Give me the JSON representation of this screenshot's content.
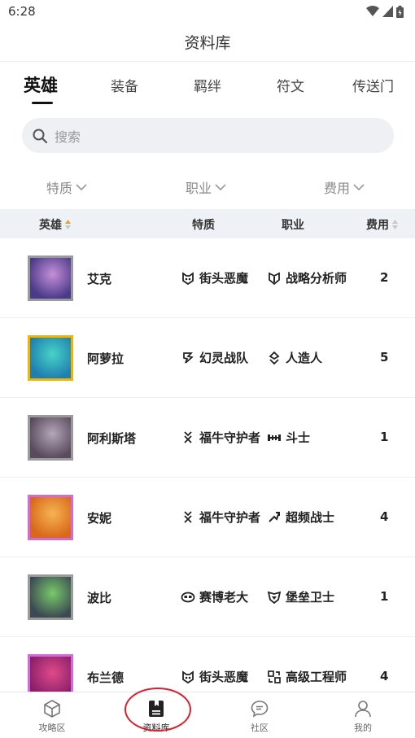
{
  "status_bar": {
    "time": "6:28"
  },
  "header": {
    "title": "资料库"
  },
  "tabs": [
    {
      "label": "英雄",
      "active": true
    },
    {
      "label": "装备",
      "active": false
    },
    {
      "label": "羁绊",
      "active": false
    },
    {
      "label": "符文",
      "active": false
    },
    {
      "label": "传送门",
      "active": false
    }
  ],
  "search": {
    "placeholder": "搜索"
  },
  "filters": [
    {
      "label": "特质"
    },
    {
      "label": "职业"
    },
    {
      "label": "费用"
    }
  ],
  "table": {
    "columns": [
      "英雄",
      "特质",
      "职业",
      "费用"
    ],
    "rows": [
      {
        "name": "艾克",
        "trait": "街头恶魔",
        "trait_icon": "street-demon-icon",
        "class": "战略分析师",
        "class_icon": "strategist-icon",
        "cost": "2",
        "border_color": "#9a9a9a",
        "portrait_colors": [
          "#4a3a8a",
          "#c58fd8"
        ]
      },
      {
        "name": "阿萝拉",
        "trait": "幻灵战队",
        "trait_icon": "star-guardian-icon",
        "class": "人造人",
        "class_icon": "cyborg-icon",
        "cost": "5",
        "border_color": "#f2b400",
        "portrait_colors": [
          "#1f7fb0",
          "#48d2c6"
        ]
      },
      {
        "name": "阿利斯塔",
        "trait": "福牛守护者",
        "trait_icon": "ox-guardian-icon",
        "class": "斗士",
        "class_icon": "bruiser-icon",
        "cost": "1",
        "border_color": "#9a9a9a",
        "portrait_colors": [
          "#5a4a5e",
          "#b3a7b8"
        ]
      },
      {
        "name": "安妮",
        "trait": "福牛守护者",
        "trait_icon": "ox-guardian-icon",
        "class": "超频战士",
        "class_icon": "overclock-icon",
        "cost": "4",
        "border_color": "#d26bd8",
        "portrait_colors": [
          "#d9681a",
          "#f5b452"
        ]
      },
      {
        "name": "波比",
        "trait": "赛博老大",
        "trait_icon": "cyber-boss-icon",
        "class": "堡垒卫士",
        "class_icon": "bastion-icon",
        "cost": "1",
        "border_color": "#9a9a9a",
        "portrait_colors": [
          "#3b4a52",
          "#78c96a"
        ]
      },
      {
        "name": "布兰德",
        "trait": "街头恶魔",
        "trait_icon": "street-demon-icon",
        "class": "高级工程师",
        "class_icon": "engineer-icon",
        "cost": "4",
        "border_color": "#d26bd8",
        "portrait_colors": [
          "#8a1f6a",
          "#e04a8a"
        ]
      }
    ]
  },
  "bottom_nav": [
    {
      "label": "攻略区",
      "icon": "cube-icon",
      "active": false
    },
    {
      "label": "资料库",
      "icon": "book-icon",
      "active": true
    },
    {
      "label": "社区",
      "icon": "chat-icon",
      "active": false
    },
    {
      "label": "我的",
      "icon": "person-icon",
      "active": false
    }
  ],
  "colors": {
    "annotation": "#d9202a",
    "header_bg": "#eef1f5",
    "sort_accent": "#f0a030"
  }
}
